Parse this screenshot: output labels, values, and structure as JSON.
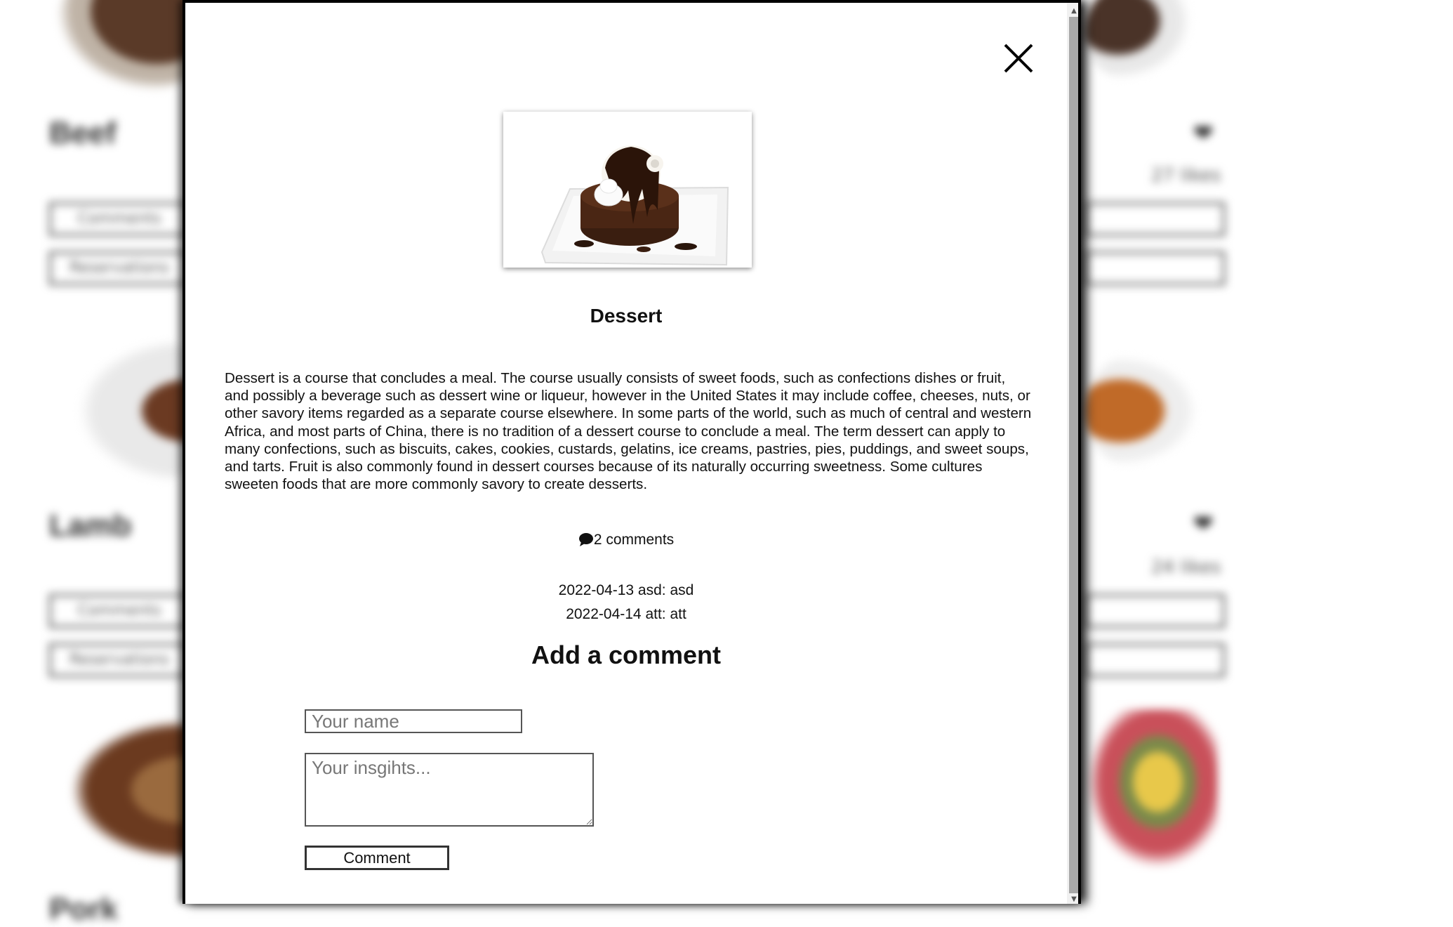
{
  "background": {
    "cards": [
      {
        "title": "Beef",
        "likes": "27 likes",
        "comments_label": "Comments",
        "reservations_label": "Reservations"
      },
      {
        "title": "Lamb",
        "likes": "24 likes",
        "comments_label": "Comments",
        "reservations_label": "Reservations"
      },
      {
        "title": "Pork",
        "likes": "",
        "comments_label": "",
        "reservations_label": ""
      }
    ]
  },
  "modal": {
    "close_icon": "close-icon",
    "dish": {
      "image_icon": "chocolate-dessert-image",
      "title": "Dessert",
      "description": "Dessert is a course that concludes a meal. The course usually consists of sweet foods, such as confections dishes or fruit, and possibly a beverage such as dessert wine or liqueur, however in the United States it may include coffee, cheeses, nuts, or other savory items regarded as a separate course elsewhere. In some parts of the world, such as much of central and western Africa, and most parts of China, there is no tradition of a dessert course to conclude a meal. The term dessert can apply to many confections, such as biscuits, cakes, cookies, custards, gelatins, ice creams, pastries, pies, puddings, and sweet soups, and tarts. Fruit is also commonly found in dessert courses because of its naturally occurring sweetness. Some cultures sweeten foods that are more commonly savory to create desserts."
    },
    "comments": {
      "count_label": "2 comments",
      "items": [
        "2022-04-13 asd: asd",
        "2022-04-14 att: att"
      ]
    },
    "form": {
      "title": "Add a comment",
      "name_placeholder": "Your name",
      "insights_placeholder": "Your insgihts...",
      "submit_label": "Comment"
    }
  },
  "colors": {
    "modal_border": "#000000",
    "text": "#111111",
    "scroll_thumb": "#a8a8a8"
  }
}
